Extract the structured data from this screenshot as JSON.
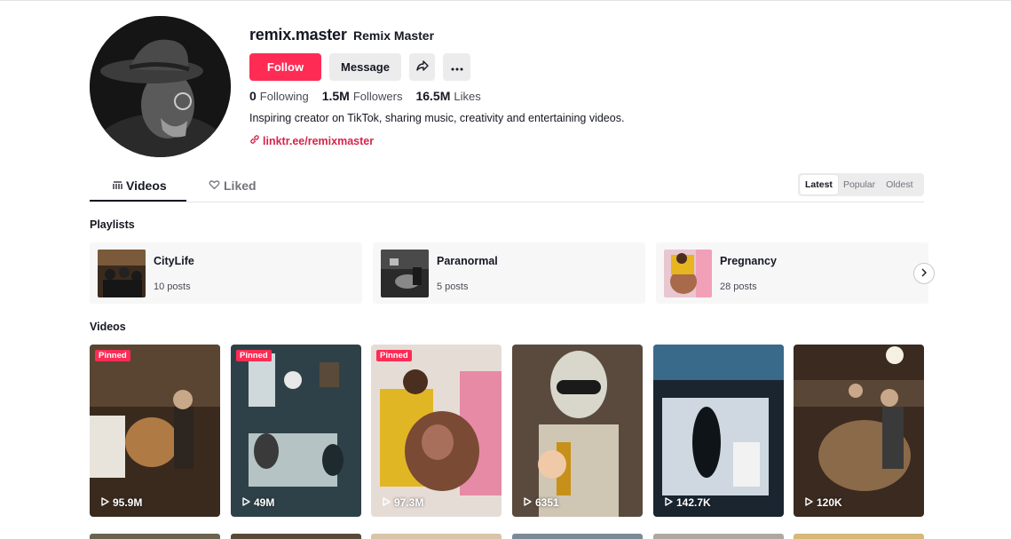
{
  "profile": {
    "username": "remix.master",
    "nickname": "Remix Master",
    "follow_label": "Follow",
    "message_label": "Message",
    "share_icon": "share-arrow-icon",
    "more_icon": "ellipsis-icon",
    "stats": {
      "following_value": "0",
      "following_label": "Following",
      "followers_value": "1.5M",
      "followers_label": "Followers",
      "likes_value": "16.5M",
      "likes_label": "Likes"
    },
    "bio": "Inspiring creator on TikTok, sharing music, creativity and entertaining videos.",
    "link": "linktr.ee/remixmaster"
  },
  "tabs": {
    "videos": "Videos",
    "liked": "Liked"
  },
  "sort": {
    "latest": "Latest",
    "popular": "Popular",
    "oldest": "Oldest",
    "selected": "Latest"
  },
  "sections": {
    "playlists": "Playlists",
    "videos": "Videos"
  },
  "playlists": [
    {
      "name": "CityLife",
      "count": "10 posts"
    },
    {
      "name": "Paranormal",
      "count": "5 posts"
    },
    {
      "name": "Pregnancy",
      "count": "28 posts"
    }
  ],
  "videos": [
    {
      "pinned": "Pinned",
      "views": "95.9M"
    },
    {
      "pinned": "Pinned",
      "views": "49M"
    },
    {
      "pinned": "Pinned",
      "views": "97.3M"
    },
    {
      "pinned": "",
      "views": "6351"
    },
    {
      "pinned": "",
      "views": "142.7K"
    },
    {
      "pinned": "",
      "views": "120K"
    }
  ],
  "colors": {
    "accent": "#fe2c55",
    "link": "#d4254a",
    "text": "#161823",
    "muted": "#73747b"
  }
}
